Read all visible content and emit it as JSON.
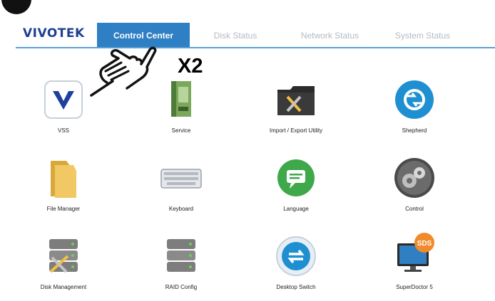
{
  "brand": {
    "logo_text": "VIVOTEK"
  },
  "tabs": [
    {
      "label": "Control Center",
      "active": true
    },
    {
      "label": "Disk Status",
      "active": false
    },
    {
      "label": "Network Status",
      "active": false
    },
    {
      "label": "System Status",
      "active": false
    }
  ],
  "annotation": {
    "multiplier": "X2"
  },
  "apps": [
    {
      "label": "VSS",
      "icon": "vss-icon"
    },
    {
      "label": "Service",
      "icon": "service-icon"
    },
    {
      "label": "Import / Export Utility",
      "icon": "import-export-icon"
    },
    {
      "label": "Shepherd",
      "icon": "shepherd-icon"
    },
    {
      "label": "File Manager",
      "icon": "folder-icon"
    },
    {
      "label": "Keyboard",
      "icon": "keyboard-icon"
    },
    {
      "label": "Language",
      "icon": "language-icon"
    },
    {
      "label": "Control",
      "icon": "gears-icon"
    },
    {
      "label": "Disk Management",
      "icon": "disk-management-icon"
    },
    {
      "label": "RAID Config",
      "icon": "raid-icon"
    },
    {
      "label": "Desktop Switch",
      "icon": "desktop-switch-icon"
    },
    {
      "label": "SuperDoctor 5",
      "icon": "superdoctor-icon"
    }
  ],
  "colors": {
    "brand": "#1e3f93",
    "accent": "#2e7fc4"
  },
  "sds_badge_text": "SDS"
}
